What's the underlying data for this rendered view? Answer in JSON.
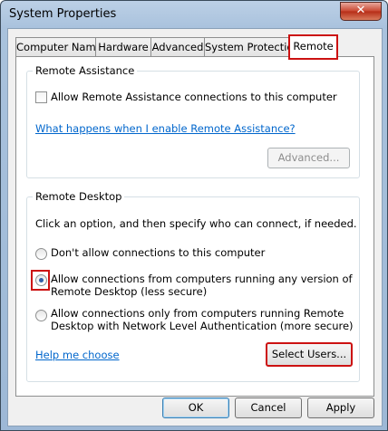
{
  "window": {
    "title": "System Properties",
    "close_glyph": "✕"
  },
  "tabs": [
    {
      "label": "Computer Name"
    },
    {
      "label": "Hardware"
    },
    {
      "label": "Advanced"
    },
    {
      "label": "System Protection"
    },
    {
      "label": "Remote",
      "selected": true
    }
  ],
  "remote_assistance": {
    "legend": "Remote Assistance",
    "checkbox_label": "Allow Remote Assistance connections to this computer",
    "checked": false,
    "help_link": "What happens when I enable Remote Assistance?",
    "advanced_button": "Advanced..."
  },
  "remote_desktop": {
    "legend": "Remote Desktop",
    "instruction": "Click an option, and then specify who can connect, if needed.",
    "options": [
      {
        "line1": "Don't allow connections to this computer",
        "line2": "",
        "selected": false
      },
      {
        "line1": "Allow connections from computers running any version of",
        "line2": "Remote Desktop (less secure)",
        "selected": true
      },
      {
        "line1": "Allow connections only from computers running Remote",
        "line2": "Desktop with Network Level Authentication (more secure)",
        "selected": false
      }
    ],
    "help_link": "Help me choose",
    "select_users_button": "Select Users..."
  },
  "footer": {
    "ok": "OK",
    "cancel": "Cancel",
    "apply": "Apply"
  },
  "colors": {
    "highlight_box": "#cc1111",
    "link": "#0066cc",
    "radio_dot": "#2f5fa8"
  }
}
